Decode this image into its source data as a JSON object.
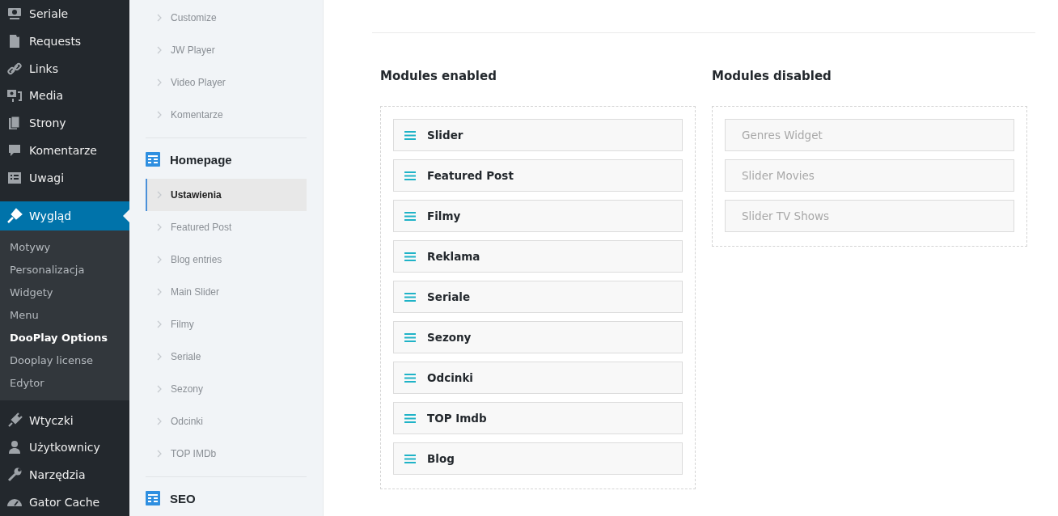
{
  "admin_menu": {
    "items": [
      {
        "label": "Seriale",
        "selected": false
      },
      {
        "label": "Requests",
        "selected": false
      },
      {
        "label": "Links",
        "selected": false
      },
      {
        "label": "Media",
        "selected": false
      },
      {
        "label": "Strony",
        "selected": false
      },
      {
        "label": "Komentarze",
        "selected": false
      },
      {
        "label": "Uwagi",
        "selected": false
      },
      {
        "label": "Wygląd",
        "selected": true,
        "children": [
          {
            "label": "Motywy",
            "selected": false
          },
          {
            "label": "Personalizacja",
            "selected": false
          },
          {
            "label": "Widgety",
            "selected": false
          },
          {
            "label": "Menu",
            "selected": false
          },
          {
            "label": "DooPlay Options",
            "selected": true
          },
          {
            "label": "Dooplay license",
            "selected": false
          },
          {
            "label": "Edytor",
            "selected": false
          }
        ]
      },
      {
        "label": "Wtyczki",
        "selected": false
      },
      {
        "label": "Użytkownicy",
        "selected": false
      },
      {
        "label": "Narzędzia",
        "selected": false
      },
      {
        "label": "Gator Cache",
        "selected": false
      }
    ]
  },
  "options_nav": {
    "groups": [
      {
        "items": [
          {
            "label": "Customize",
            "selected": false
          },
          {
            "label": "JW Player",
            "selected": false
          },
          {
            "label": "Video Player",
            "selected": false
          },
          {
            "label": "Komentarze",
            "selected": false
          }
        ]
      },
      {
        "title": "Homepage",
        "items": [
          {
            "label": "Ustawienia",
            "selected": true
          },
          {
            "label": "Featured Post",
            "selected": false
          },
          {
            "label": "Blog entries",
            "selected": false
          },
          {
            "label": "Main Slider",
            "selected": false
          },
          {
            "label": "Filmy",
            "selected": false
          },
          {
            "label": "Seriale",
            "selected": false
          },
          {
            "label": "Sezony",
            "selected": false
          },
          {
            "label": "Odcinki",
            "selected": false
          },
          {
            "label": "TOP IMDb",
            "selected": false
          }
        ]
      },
      {
        "title": "SEO"
      }
    ]
  },
  "modules": {
    "enabled": {
      "title": "Modules enabled",
      "items": [
        "Slider",
        "Featured Post",
        "Filmy",
        "Reklama",
        "Seriale",
        "Sezony",
        "Odcinki",
        "TOP Imdb",
        "Blog"
      ]
    },
    "disabled": {
      "title": "Modules disabled",
      "items": [
        "Genres Widget",
        "Slider Movies",
        "Slider TV Shows"
      ]
    }
  }
}
